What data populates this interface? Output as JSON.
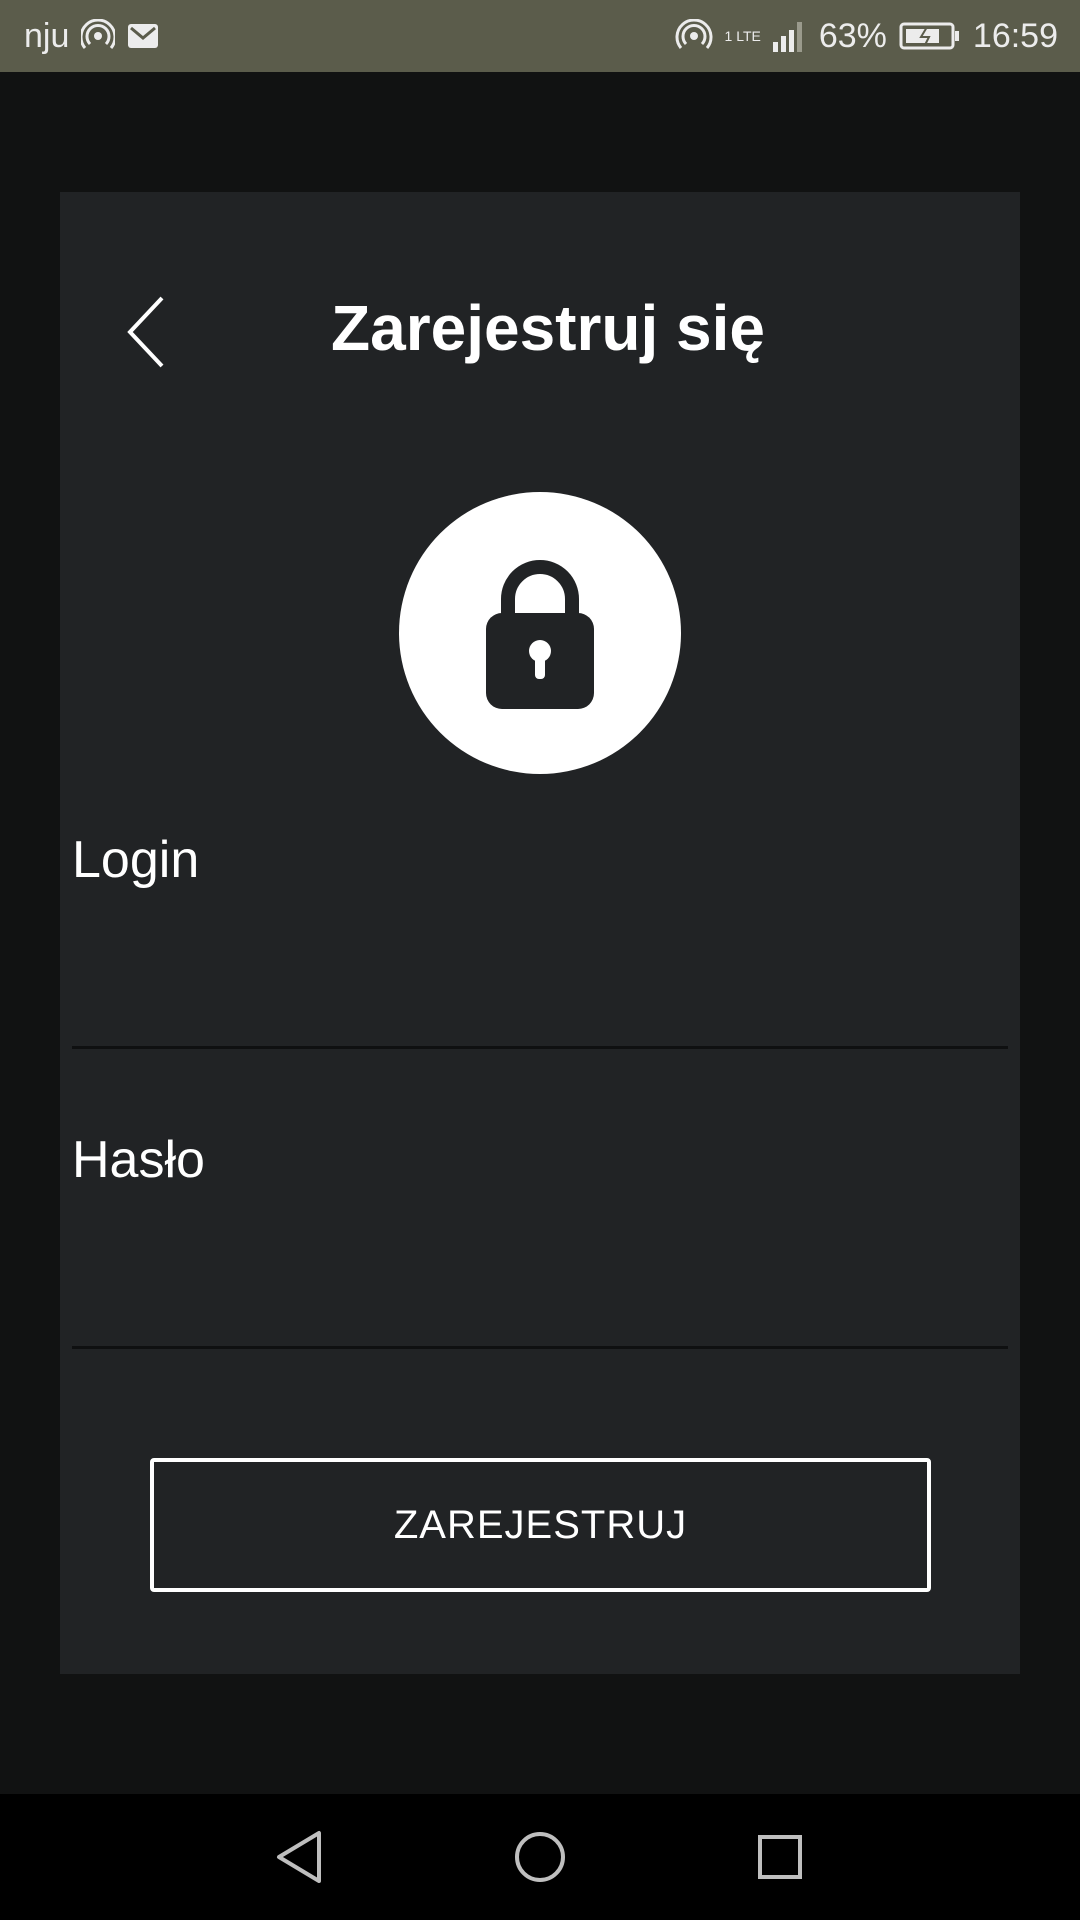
{
  "status_bar": {
    "carrier": "nju",
    "network": "1",
    "network_type": "LTE",
    "battery": "63%",
    "time": "16:59",
    "icons": [
      "hotspot-icon",
      "mail-icon",
      "hotspot-icon",
      "signal-icon",
      "battery-charging-icon"
    ]
  },
  "header": {
    "title": "Zarejestruj się",
    "back_icon": "chevron-left-icon"
  },
  "lock": {
    "icon": "lock-icon"
  },
  "form": {
    "login_label": "Login",
    "login_value": "",
    "password_label": "Hasło",
    "password_value": ""
  },
  "actions": {
    "register_label": "ZAREJESTRUJ"
  },
  "nav": {
    "icons": [
      "back-triangle-icon",
      "home-circle-icon",
      "recents-square-icon"
    ]
  },
  "colors": {
    "card": "#212325",
    "background": "#111212",
    "status_bar": "#5b5c4b",
    "accent": "#ffffff"
  }
}
